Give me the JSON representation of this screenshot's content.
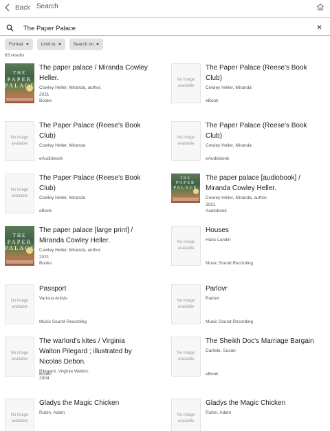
{
  "nav": {
    "back_label": "Back",
    "title": "Search"
  },
  "search": {
    "query": "The Paper Palace"
  },
  "filters": [
    "Format",
    "Limit to",
    "Search on"
  ],
  "results_count": "63 results",
  "thumb_no_image": "No image available",
  "cover_text": [
    "THE",
    "PAPER",
    "PALACE"
  ],
  "results": [
    {
      "title_lines": [
        "The paper palace / Miranda Cowley",
        "Heller."
      ],
      "author": "Cowley Heller, Miranda, author.",
      "year": "2021",
      "format": "Books",
      "cover": true
    },
    {
      "title_lines": [
        "The Paper Palace (Reese's Book",
        "Club)"
      ],
      "author": "Cowley Heller, Miranda",
      "year": "",
      "format": "eBook",
      "cover": false
    },
    {
      "title_lines": [
        "The Paper Palace (Reese's Book",
        "Club)"
      ],
      "author": "Cowley Heller, Miranda",
      "year": "",
      "format": "eAudiobook",
      "cover": false
    },
    {
      "title_lines": [
        "The Paper Palace (Reese's Book",
        "Club)"
      ],
      "author": "Cowley Heller, Miranda",
      "year": "",
      "format": "eAudiobook",
      "cover": false
    },
    {
      "title_lines": [
        "The Paper Palace (Reese's Book",
        "Club)"
      ],
      "author": "Cowley Heller, Miranda",
      "year": "",
      "format": "eBook",
      "cover": false
    },
    {
      "title_lines": [
        "The paper palace [audiobook] /",
        "Miranda Cowley Heller."
      ],
      "author": "Cowley Heller, Miranda, author.",
      "year": "2021",
      "format": "Audiobook",
      "cover": true
    },
    {
      "title_lines": [
        "The paper palace [large print] /",
        "Miranda Cowley Heller."
      ],
      "author": "Cowley Heller, Miranda, author.",
      "year": "2021",
      "format": "Books",
      "cover": true
    },
    {
      "title_lines": [
        "Houses"
      ],
      "author": "Hans Lundin",
      "year": "",
      "format": "Music Sound Recording",
      "cover": false
    },
    {
      "title_lines": [
        "Passport"
      ],
      "author": "Various Artists",
      "year": "",
      "format": "Music Sound Recording",
      "cover": false
    },
    {
      "title_lines": [
        "Parlovr"
      ],
      "author": "Parlovr",
      "year": "",
      "format": "Music Sound Recording",
      "cover": false
    },
    {
      "title_lines": [
        "The warlord's kites / Virginia",
        "Walton Pilegard ; illustrated by",
        "Nicolas Debon."
      ],
      "author": "Pilegard, Virginia Walton.",
      "year": "2004",
      "format": "Books",
      "cover": false
    },
    {
      "title_lines": [
        "The Sheikh Doc's Marriage Bargain"
      ],
      "author": "Carlisle, Susan",
      "year": "",
      "format": "eBook",
      "cover": false
    },
    {
      "title_lines": [
        "Gladys the Magic Chicken"
      ],
      "author": "Rubin, Adam",
      "year": "",
      "format": "",
      "cover": false
    },
    {
      "title_lines": [
        "Gladys the Magic Chicken"
      ],
      "author": "Rubin, Adam",
      "year": "",
      "format": "",
      "cover": false
    }
  ]
}
